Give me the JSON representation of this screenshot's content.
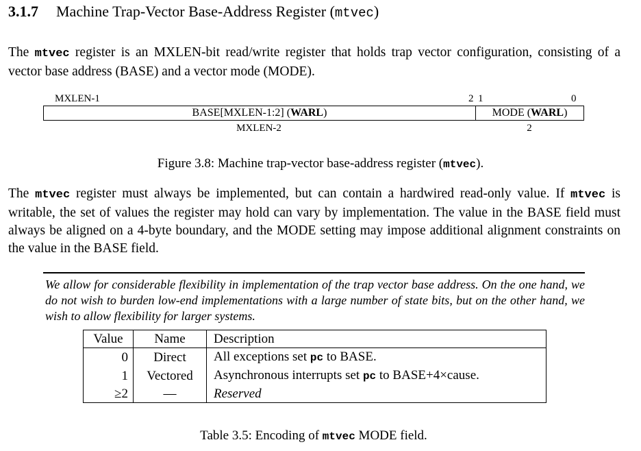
{
  "section": {
    "number": "3.1.7",
    "title": "Machine Trap-Vector Base-Address Register (",
    "title_code": "mtvec",
    "title_end": ")"
  },
  "paragraph1": {
    "pre": "The ",
    "code": "mtvec",
    "post": " register is an MXLEN-bit read/write register that holds trap vector configuration, consisting of a vector base address (BASE) and a vector mode (MODE)."
  },
  "register_diagram": {
    "bit_labels": {
      "left_msb": "MXLEN-1",
      "base_lsb": "2",
      "mode_msb": "1",
      "mode_lsb": "0"
    },
    "fields": [
      {
        "name": "BASE[MXLEN-1:2] (",
        "attr": "WARL",
        "end": ")",
        "width_label": "MXLEN-2"
      },
      {
        "name": "MODE (",
        "attr": "WARL",
        "end": ")",
        "width_label": "2"
      }
    ]
  },
  "figure_caption": {
    "pre": "Figure 3.8: Machine trap-vector base-address register (",
    "code": "mtvec",
    "post": ")."
  },
  "paragraph2": {
    "pre": "The ",
    "code1": "mtvec",
    "mid1": " register must always be implemented, but can contain a hardwired read-only value. If ",
    "code2": "mtvec",
    "post": " is writable, the set of values the register may hold can vary by implementation. The value in the BASE field must always be aligned on a 4-byte boundary, and the MODE setting may impose additional alignment constraints on the value in the BASE field."
  },
  "commentary": {
    "text": "We allow for considerable flexibility in implementation of the trap vector base address. On the one hand, we do not wish to burden low-end implementations with a large number of state bits, but on the other hand, we wish to allow flexibility for larger systems."
  },
  "mode_table": {
    "headers": [
      "Value",
      "Name",
      "Description"
    ],
    "rows": [
      {
        "value": "0",
        "name": "Direct",
        "desc_pre": "All exceptions set ",
        "desc_code": "pc",
        "desc_post": " to BASE."
      },
      {
        "value": "1",
        "name": "Vectored",
        "desc_pre": "Asynchronous interrupts set ",
        "desc_code": "pc",
        "desc_post": " to BASE+4×cause."
      },
      {
        "value": "≥2",
        "name": "—",
        "desc_pre": "Reserved",
        "desc_code": "",
        "desc_post": ""
      }
    ]
  },
  "table_caption": {
    "pre": "Table 3.5: Encoding of ",
    "code": "mtvec",
    "post": " MODE field."
  }
}
